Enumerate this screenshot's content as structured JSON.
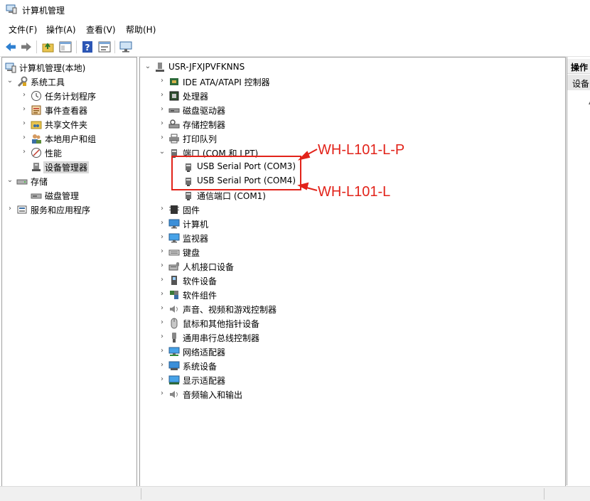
{
  "window": {
    "title": "计算机管理"
  },
  "menu": {
    "items": [
      "文件(F)",
      "操作(A)",
      "查看(V)",
      "帮助(H)"
    ]
  },
  "toolbar": {
    "buttons": [
      "back-arrow-icon",
      "forward-arrow-icon",
      "up-folder-icon",
      "show-hide-tree-icon",
      "help-icon",
      "properties-icon",
      "monitor-icon"
    ]
  },
  "left_tree": {
    "root": "计算机管理(本地)",
    "system_tools": "系统工具",
    "task_scheduler": "任务计划程序",
    "event_viewer": "事件查看器",
    "shared_folders": "共享文件夹",
    "local_users": "本地用户和组",
    "performance": "性能",
    "device_manager": "设备管理器",
    "storage": "存储",
    "disk_management": "磁盘管理",
    "services_apps": "服务和应用程序"
  },
  "device_tree": {
    "computer_name": "USR-JFXJPVFKNNS",
    "categories": {
      "ide": "IDE ATA/ATAPI 控制器",
      "processor": "处理器",
      "disk": "磁盘驱动器",
      "storage_ctrl": "存储控制器",
      "print_queue": "打印队列",
      "ports": "端口 (COM 和 LPT)",
      "firmware": "固件",
      "computer": "计算机",
      "monitor": "监视器",
      "keyboard": "键盘",
      "hid": "人机接口设备",
      "software_device": "软件设备",
      "software_component": "软件组件",
      "sound": "声音、视频和游戏控制器",
      "mouse": "鼠标和其他指针设备",
      "usb": "通用串行总线控制器",
      "network": "网络适配器",
      "system": "系统设备",
      "display": "显示适配器",
      "audio_io": "音频输入和输出"
    },
    "ports": {
      "com3": "USB Serial Port (COM3)",
      "com4": "USB Serial Port (COM4)",
      "com1": "通信端口 (COM1)"
    }
  },
  "actions_pane": {
    "header": "操作",
    "item": "设备"
  },
  "annotations": {
    "top": "WH-L101-L-P",
    "bottom": "WH-L101-L",
    "color": "#e2231a"
  }
}
